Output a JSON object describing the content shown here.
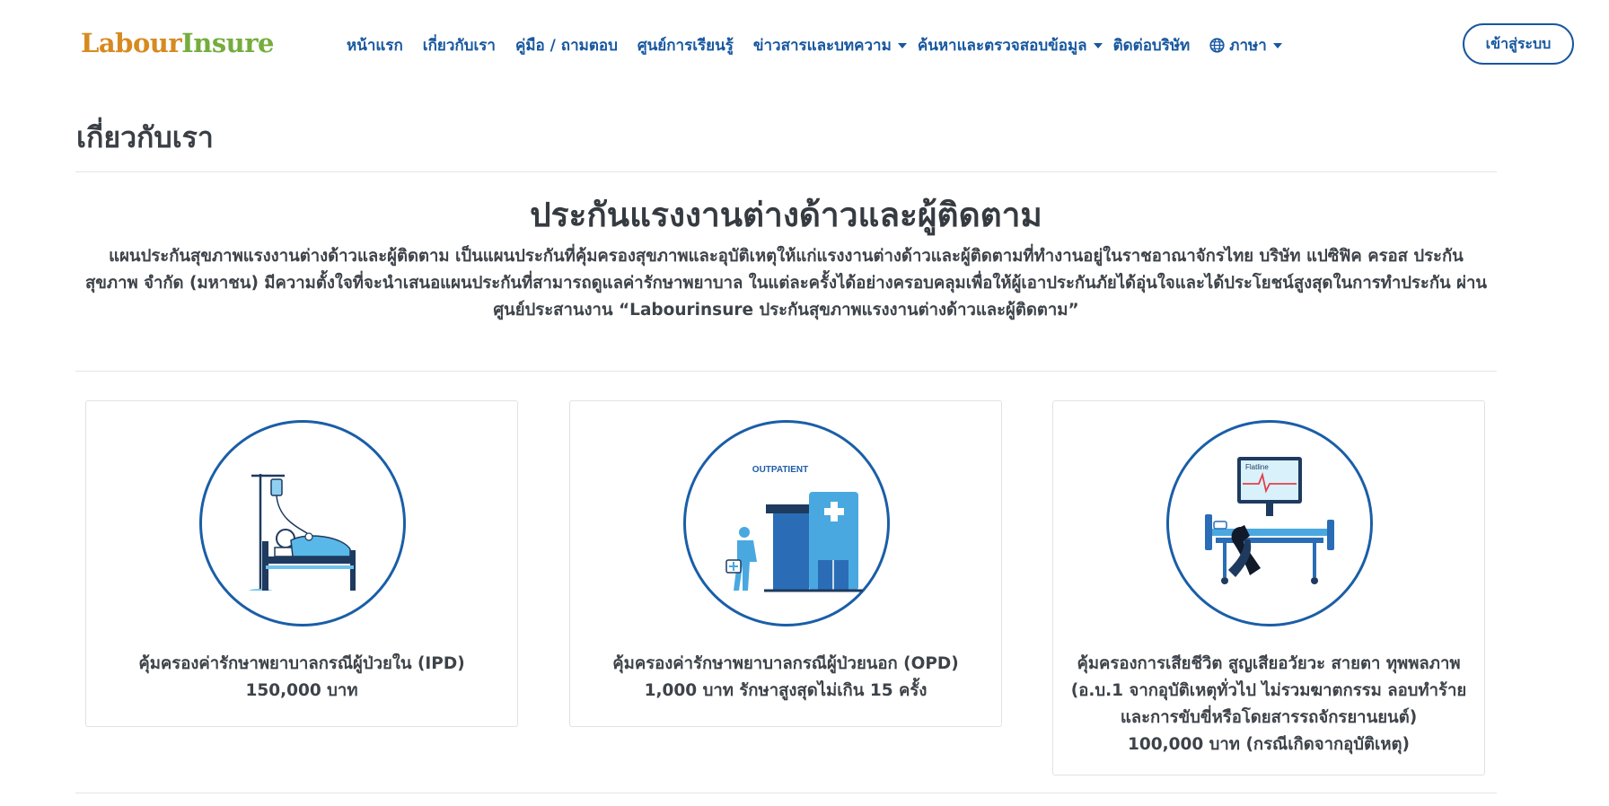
{
  "brand": {
    "logo_part1": "Labour",
    "logo_part2": "Insure"
  },
  "nav": {
    "items": [
      {
        "label": "หน้าแรก"
      },
      {
        "label": "เกี่ยวกับเรา"
      },
      {
        "label": "คู่มือ / ถามตอบ"
      },
      {
        "label": "ศูนย์การเรียนรู้"
      },
      {
        "label": "ข่าวสารและบทความ"
      },
      {
        "label": "ค้นหาและตรวจสอบข้อมูล"
      },
      {
        "label": "ติดต่อบริษัท"
      },
      {
        "label": "ภาษา"
      }
    ],
    "login_label": "เข้าสู่ระบบ"
  },
  "page": {
    "title": "เกี่ยวกับเรา",
    "hero_title": "ประกันแรงงานต่างด้าวและผู้ติดตาม",
    "intro_lines": [
      "แผนประกันสุขภาพแรงงานต่างด้าวและผู้ติดตาม เป็นแผนประกันที่คุ้มครองสุขภาพและอุบัติเหตุให้แก่แรงงานต่างด้าวและผู้ติดตามที่ทำงานอยู่ในราชอาณาจักรไทย บริษัท แปซิฟิค ครอส ประกัน",
      "สุขภาพ จำกัด (มหาชน) มีความตั้งใจที่จะนำเสนอแผนประกันที่สามารถดูแลค่ารักษาพยาบาล ในแต่ละครั้งได้อย่างครอบคลุมเพื่อให้ผู้เอาประกันภัยได้อุ่นใจและได้ประโยชน์สูงสุดในการทำประกัน ผ่าน",
      "ศูนย์ประสานงาน “Labourinsure ประกันสุขภาพแรงงานต่างด้าวและผู้ติดตาม”"
    ]
  },
  "cards": [
    {
      "icon": "hospital-bed-patient-icon",
      "lines": [
        "คุ้มครองค่ารักษาพยาบาลกรณีผู้ป่วยใน (IPD)",
        "150,000 บาท"
      ]
    },
    {
      "icon": "outpatient-clinic-icon",
      "icon_text": "OUTPATIENT",
      "lines": [
        "คุ้มครองค่ารักษาพยาบาลกรณีผู้ป่วยนอก (OPD)",
        "1,000 บาท รักษาสูงสุดไม่เกิน 15 ครั้ง"
      ]
    },
    {
      "icon": "flatline-monitor-ribbon-icon",
      "icon_text": "Flatline",
      "lines": [
        "คุ้มครองการเสียชีวิต สูญเสียอวัยวะ สายตา ทุพพลภาพ",
        "(อ.บ.1 จากอุบัติเหตุทั่วไป ไม่รวมฆาตกรรม ลอบทำร้าย",
        "และการขับขี่หรือโดยสารรถจักรยานยนต์)",
        "100,000 บาท (กรณีเกิดจากอุบัติเหตุ)"
      ]
    }
  ],
  "colors": {
    "brand_blue": "#17579f",
    "logo_orange": "#d78a1f",
    "logo_green": "#74ad3e",
    "icon_blue": "#2f86c8"
  }
}
